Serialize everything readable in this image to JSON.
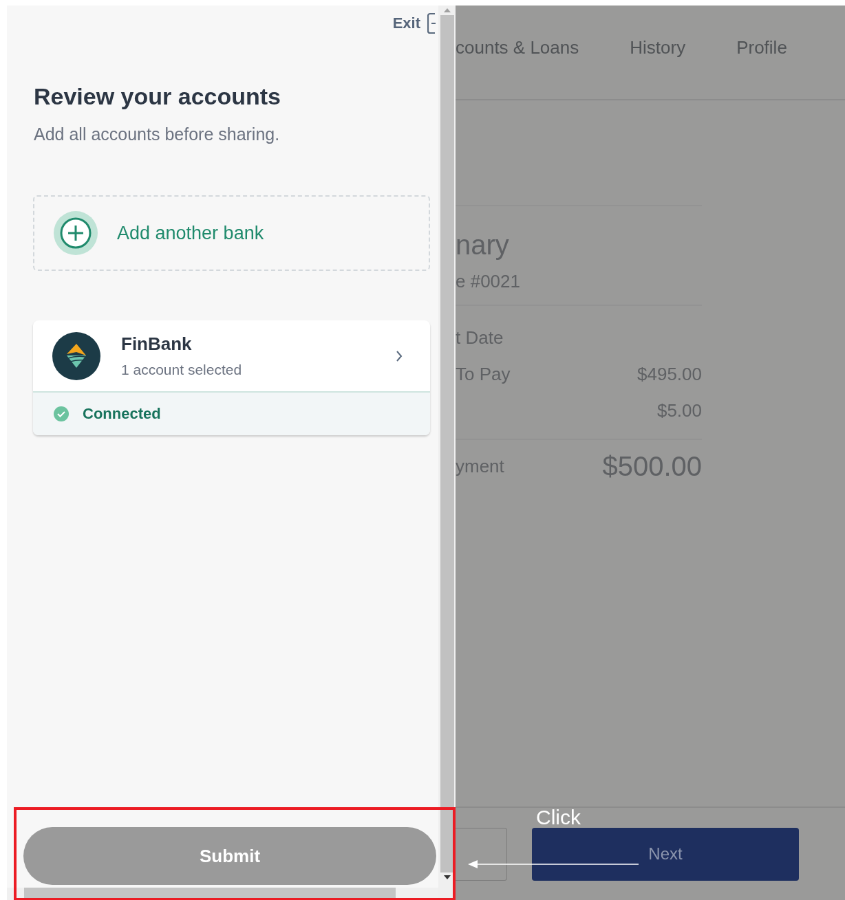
{
  "panel": {
    "exit_label": "Exit",
    "title": "Review your accounts",
    "subtitle": "Add all accounts before sharing.",
    "add_bank_label": "Add another bank",
    "banks": [
      {
        "name": "FinBank",
        "detail": "1 account selected",
        "status": "Connected",
        "connected": true
      }
    ],
    "submit": {
      "label": "Submit",
      "disabled": true
    }
  },
  "background": {
    "nav": [
      "counts & Loans",
      "History",
      "Profile"
    ],
    "summary_title": "nary",
    "invoice": "e #0021",
    "rows": [
      {
        "label": "t Date"
      },
      {
        "label": "To Pay",
        "value": "$495.00"
      },
      {
        "value": "$5.00"
      }
    ],
    "total": {
      "label": "yment",
      "value": "$500.00"
    },
    "next_label": "Next"
  },
  "annotation": {
    "text": "Click"
  }
}
